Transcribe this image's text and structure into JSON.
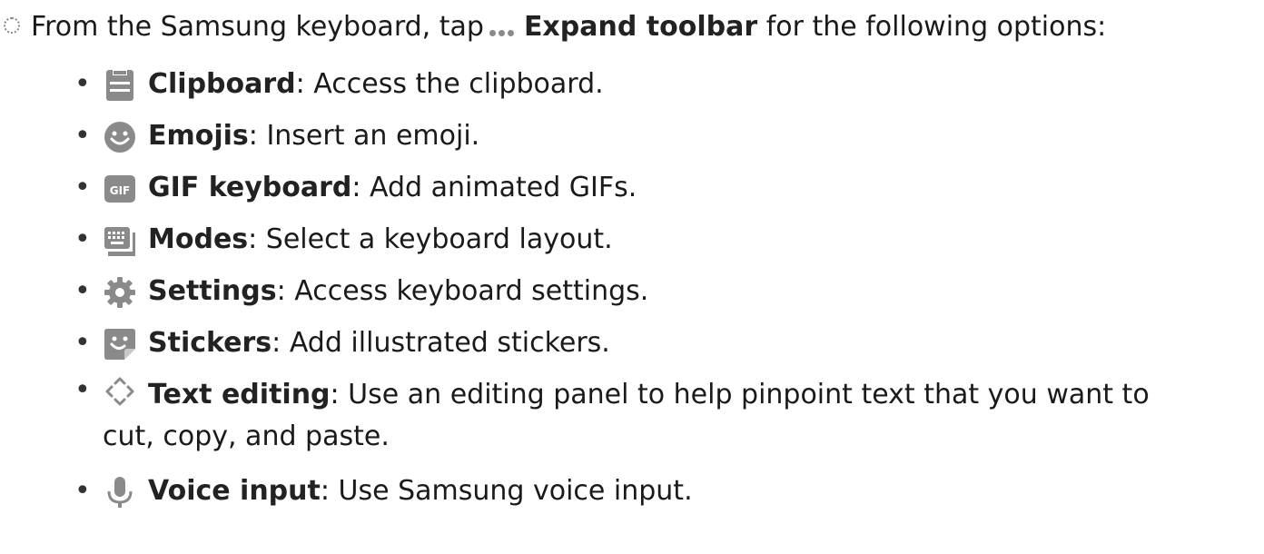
{
  "intro": {
    "before": "From the Samsung keyboard, tap",
    "emphasis": "Expand toolbar",
    "after": "for the following options:"
  },
  "options": [
    {
      "icon": "clipboard-icon",
      "name": "Clipboard",
      "description": ": Access the clipboard."
    },
    {
      "icon": "emoji-icon",
      "name": "Emojis",
      "description": ": Insert an emoji."
    },
    {
      "icon": "gif-icon",
      "name": "GIF keyboard",
      "description": ": Add animated GIFs."
    },
    {
      "icon": "keyboard-modes-icon",
      "name": "Modes",
      "description": ": Select a keyboard layout."
    },
    {
      "icon": "gear-icon",
      "name": "Settings",
      "description": ": Access keyboard settings."
    },
    {
      "icon": "sticker-icon",
      "name": "Stickers",
      "description": ": Add illustrated stickers."
    },
    {
      "icon": "text-editing-icon",
      "name": "Text editing",
      "description": ": Use an editing panel to help pinpoint text that you want to",
      "description_cont": "cut, copy, and paste."
    },
    {
      "icon": "microphone-icon",
      "name": "Voice input",
      "description": ": Use Samsung voice input."
    }
  ],
  "icon_gif_text": "GIF",
  "colors": {
    "icon_gray": "#8a8a8a",
    "text": "#1a1a1a"
  }
}
